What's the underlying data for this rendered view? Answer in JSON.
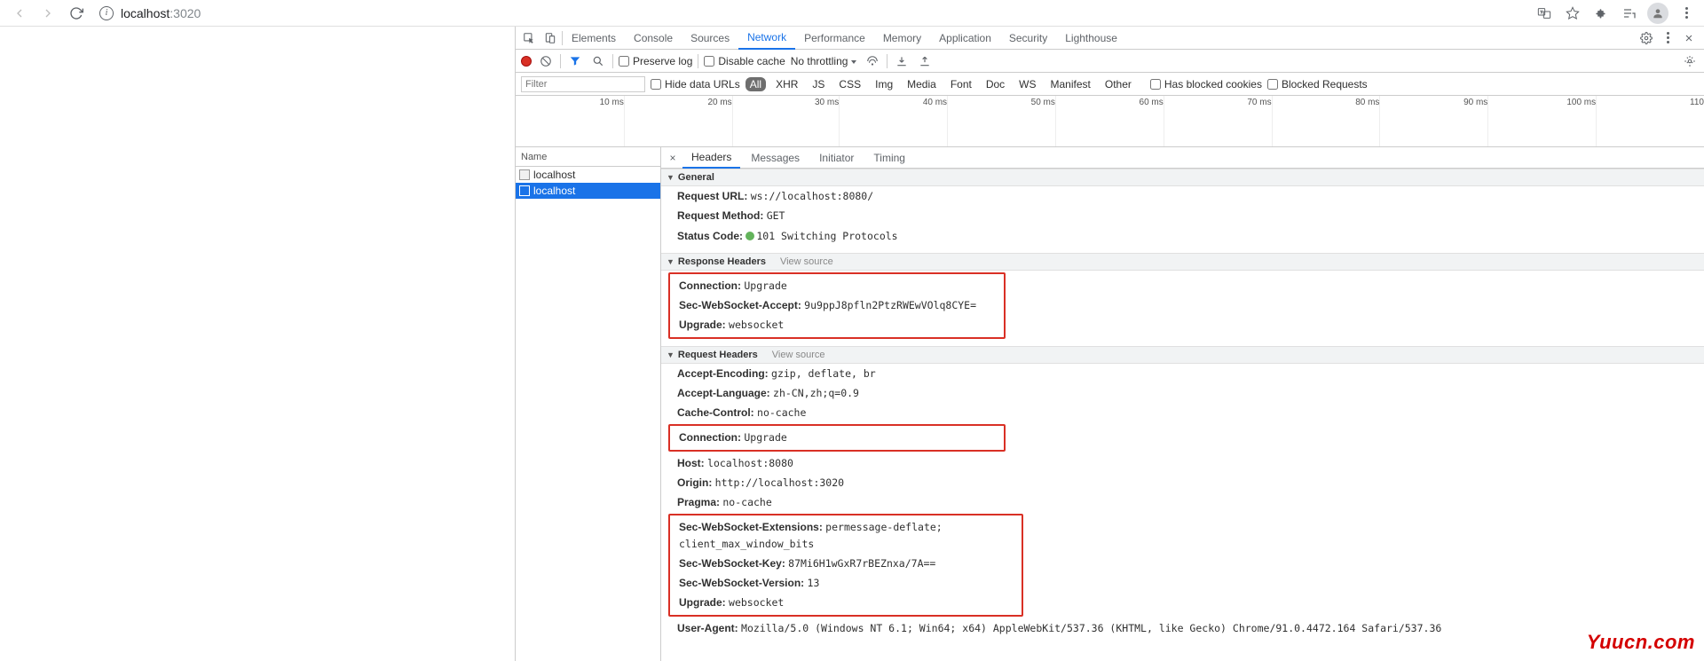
{
  "browser": {
    "address_host": "localhost",
    "address_path": ":3020"
  },
  "devtools": {
    "tabs": [
      "Elements",
      "Console",
      "Sources",
      "Network",
      "Performance",
      "Memory",
      "Application",
      "Security",
      "Lighthouse"
    ],
    "active_tab": "Network"
  },
  "toolbar": {
    "preserve_log": "Preserve log",
    "disable_cache": "Disable cache",
    "throttling": "No throttling"
  },
  "filter": {
    "placeholder": "Filter",
    "hide_data_urls": "Hide data URLs",
    "types": [
      "All",
      "XHR",
      "JS",
      "CSS",
      "Img",
      "Media",
      "Font",
      "Doc",
      "WS",
      "Manifest",
      "Other"
    ],
    "active_type": "All",
    "has_blocked_cookies": "Has blocked cookies",
    "blocked_requests": "Blocked Requests"
  },
  "timeline": {
    "ticks": [
      "10 ms",
      "20 ms",
      "30 ms",
      "40 ms",
      "50 ms",
      "60 ms",
      "70 ms",
      "80 ms",
      "90 ms",
      "100 ms",
      "110"
    ]
  },
  "request_list": {
    "header": "Name",
    "rows": [
      {
        "name": "localhost",
        "selected": false
      },
      {
        "name": "localhost",
        "selected": true
      }
    ]
  },
  "details": {
    "tabs": [
      "Headers",
      "Messages",
      "Initiator",
      "Timing"
    ],
    "active_tab": "Headers",
    "general": {
      "title": "General",
      "request_url_label": "Request URL:",
      "request_url": "ws://localhost:8080/",
      "request_method_label": "Request Method:",
      "request_method": "GET",
      "status_code_label": "Status Code:",
      "status_code": "101 Switching Protocols"
    },
    "response_headers": {
      "title": "Response Headers",
      "view_source": "View source",
      "connection_label": "Connection:",
      "connection": "Upgrade",
      "swa_label": "Sec-WebSocket-Accept:",
      "swa": "9u9ppJ8pfln2PtzRWEwVOlq8CYE=",
      "upgrade_label": "Upgrade:",
      "upgrade": "websocket"
    },
    "request_headers": {
      "title": "Request Headers",
      "view_source": "View source",
      "ae_label": "Accept-Encoding:",
      "ae": "gzip, deflate, br",
      "al_label": "Accept-Language:",
      "al": "zh-CN,zh;q=0.9",
      "cc_label": "Cache-Control:",
      "cc": "no-cache",
      "conn_label": "Connection:",
      "conn": "Upgrade",
      "host_label": "Host:",
      "host": "localhost:8080",
      "origin_label": "Origin:",
      "origin": "http://localhost:3020",
      "pragma_label": "Pragma:",
      "pragma": "no-cache",
      "swe_label": "Sec-WebSocket-Extensions:",
      "swe": "permessage-deflate; client_max_window_bits",
      "swk_label": "Sec-WebSocket-Key:",
      "swk": "87Mi6H1wGxR7rBEZnxa/7A==",
      "swv_label": "Sec-WebSocket-Version:",
      "swv": "13",
      "up_label": "Upgrade:",
      "up": "websocket",
      "ua_label": "User-Agent:",
      "ua": "Mozilla/5.0 (Windows NT 6.1; Win64; x64) AppleWebKit/537.36 (KHTML, like Gecko) Chrome/91.0.4472.164 Safari/537.36"
    }
  },
  "watermark": "Yuucn.com"
}
